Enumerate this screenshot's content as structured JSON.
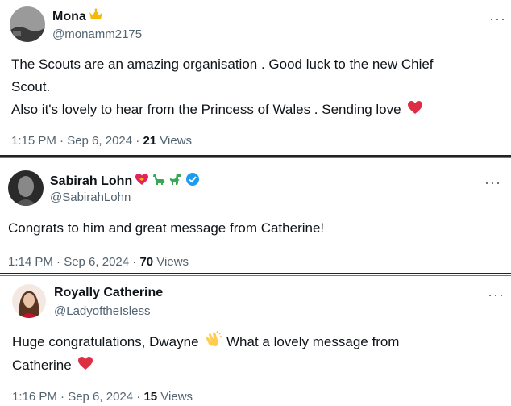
{
  "tweets": [
    {
      "name": "Mona",
      "name_emoji": "crown-icon",
      "handle": "@monamm2175",
      "lines": [
        "The Scouts are an amazing organisation . Good luck to the new Chief",
        "Scout.",
        "Also it's lovely to hear from the Princess of Wales . Sending love"
      ],
      "end_emoji": "red-heart-icon",
      "time": "1:15 PM · Sep 6, 2024 · ",
      "views_count": "21",
      "views_label": " Views",
      "more": "···"
    },
    {
      "name": "Sabirah Lohn",
      "name_emoji": [
        "heart-with-ribbon-icon",
        "sauropod-icon",
        "t-rex-icon"
      ],
      "verified": true,
      "handle": "@SabirahLohn",
      "lines": [
        "Congrats to him and great message from Catherine!"
      ],
      "time": "1:14 PM · Sep 6, 2024 · ",
      "views_count": "70",
      "views_label": " Views",
      "more": "···"
    },
    {
      "name": "Royally Catherine",
      "handle": "@LadyoftheIsless",
      "lines": [
        "Huge congratulations, Dwayne",
        "What a lovely message from",
        "Catherine"
      ],
      "mid_emoji": "clapping-hands-icon",
      "end_emoji": "red-heart-icon",
      "time": "1:16 PM · Sep 6, 2024 · ",
      "views_count": "15",
      "views_label": " Views",
      "more": "···"
    }
  ],
  "colors": {
    "text": "#0f1419",
    "muted": "#536471",
    "verified": "#1d9bf0",
    "heart": "#e0245e"
  }
}
